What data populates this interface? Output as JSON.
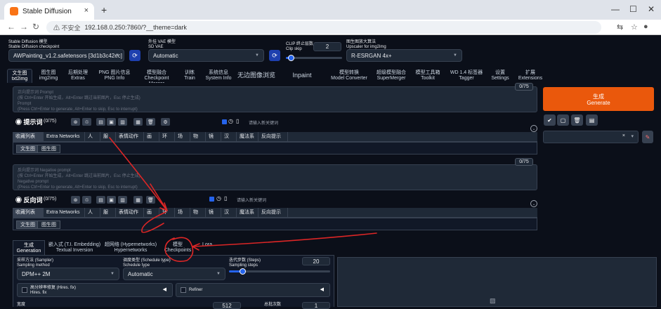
{
  "browser": {
    "tab_title": "Stable Diffusion",
    "tab_close": "×",
    "new_tab": "+",
    "minimize": "—",
    "maximize": "☐",
    "close": "✕",
    "back": "←",
    "forward": "→",
    "reload": "↻",
    "security": "⚠ 不安全",
    "url": "192.168.0.250:7860/?__theme=dark"
  },
  "top_controls": {
    "model_label_cn": "Stable Diffusion 模型",
    "model_label_en": "Stable Diffusion checkpoint",
    "model_value": "AWPainting_v1.2.safetensors [3d1b3c42ec]",
    "vae_label_cn": "外挂 VAE 模型",
    "vae_label_en": "SD VAE",
    "vae_value": "Automatic",
    "clip_label_cn": "CLIP 终止层数",
    "clip_label_en": "Clip skip",
    "clip_value": "2",
    "clip_fraction": 0.09,
    "upscaler_label_cn": "图生图放大算法",
    "upscaler_label_en": "Upscaler for img2img",
    "upscaler_value": "R-ESRGAN 4x+"
  },
  "main_tabs": [
    {
      "cn": "文生图",
      "en": "txt2img"
    },
    {
      "cn": "图生图",
      "en": "img2img"
    },
    {
      "cn": "后期处理",
      "en": "Extras"
    },
    {
      "cn": "PNG 图片信息",
      "en": "PNG Info"
    },
    {
      "cn": "模型融合",
      "en": "Checkpoint Merger"
    },
    {
      "cn": "训练",
      "en": "Train"
    },
    {
      "cn": "系统信息",
      "en": "System Info"
    },
    {
      "cn": "无边图像浏览",
      "en": ""
    },
    {
      "cn": "Inpaint Anything",
      "en": ""
    },
    {
      "cn": "模型转换",
      "en": "Model Converter"
    },
    {
      "cn": "超级模型融合",
      "en": "SuperMerger"
    },
    {
      "cn": "模型工具箱",
      "en": "Toolkit"
    },
    {
      "cn": "WD 1.4 标签器",
      "en": "Tagger"
    },
    {
      "cn": "设置",
      "en": "Settings"
    },
    {
      "cn": "扩展",
      "en": "Extensions"
    }
  ],
  "prompt": {
    "placeholder_1": "正向提示词 Prompt",
    "placeholder_2": "(按 Ctrl+Enter 开始生成，Alt+Enter 跳过当前图片，Esc 停止生成)",
    "placeholder_3": "Prompt",
    "placeholder_4": "(Press Ctrl+Enter to generate, Alt+Enter to skip, Esc to interrupt)",
    "counter": "0/75",
    "row_title": "提示词",
    "row_count": "(0/75)",
    "keyword_placeholder": "请输入新关键词"
  },
  "neg_prompt": {
    "placeholder_1": "反向提示词 Negative prompt",
    "placeholder_2": "(按 Ctrl+Enter 开始生成，Alt+Enter 跳过当前图片，Esc 停止生成)",
    "placeholder_3": "Negative prompt",
    "placeholder_4": "(Press Ctrl+Enter to generate, Alt+Enter to skip, Esc to interrupt)",
    "counter": "0/75",
    "row_title": "反向词",
    "row_count": "(0/75)",
    "keyword_placeholder": "请输入新关键词"
  },
  "category_tabs": [
    "收藏列表",
    "Extra Networks",
    "人物",
    "服饰",
    "表情动作",
    "画面",
    "环境",
    "场景",
    "物品",
    "镜头",
    "汉服",
    "魔法系",
    "反向提示词"
  ],
  "sub_tabs": [
    "文生图",
    "图生图"
  ],
  "toolbar_icons": [
    "⊛",
    "♲",
    "▤",
    "▣",
    "🗑",
    "⚙"
  ],
  "generate": {
    "cn": "生成",
    "en": "Generate"
  },
  "action_icons": [
    "✔",
    "▢",
    "🗑",
    "▤"
  ],
  "style_clear": "×",
  "style_arrow": "▾",
  "paint_icon": "✎",
  "gen_tabs": [
    {
      "cn": "生成",
      "en": "Generation"
    },
    {
      "cn": "嵌入式 (T.I. Embedding)",
      "en": "Textual Inversion"
    },
    {
      "cn": "超网络 (Hypernetworks)",
      "en": "Hypernetworks"
    },
    {
      "cn": "模型",
      "en": "Checkpoints"
    },
    {
      "cn": "Lora",
      "en": ""
    }
  ],
  "generation": {
    "sampler_label_cn": "采样方法 (Sampler)",
    "sampler_label_en": "Sampling method",
    "sampler_value": "DPM++ 2M",
    "schedule_label_cn": "调度类型 (Schedule type)",
    "schedule_label_en": "Schedule type",
    "schedule_value": "Automatic",
    "steps_label_cn": "迭代步数 (Steps)",
    "steps_label_en": "Sampling steps",
    "steps_value": "20",
    "steps_fraction": 0.13,
    "hires_cn": "高分辨率修复 (Hires. fix)",
    "hires_en": "Hires. fix",
    "refiner": "Refiner",
    "width_label": "宽度",
    "width_value": "512",
    "batch_label": "总批次数",
    "batch_value": "1"
  },
  "accent_colors": {
    "generate": "#ea580c",
    "button": "#1e40af",
    "annotation": "#dc2626"
  }
}
